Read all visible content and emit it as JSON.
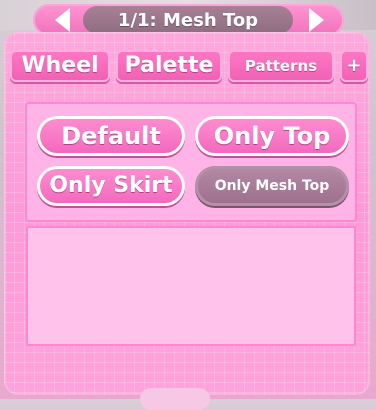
{
  "header": {
    "title": "1/1: Mesh Top",
    "prev_icon": "left-arrow-icon",
    "next_icon": "right-arrow-icon"
  },
  "tabs": [
    {
      "label": "Wheel"
    },
    {
      "label": "Palette"
    },
    {
      "label": "Patterns"
    },
    {
      "label": "+"
    }
  ],
  "presets": [
    {
      "label": "Default",
      "state": "active"
    },
    {
      "label": "Only Top",
      "state": "active"
    },
    {
      "label": "Only Skirt",
      "state": "active"
    },
    {
      "label": "Only Mesh Top",
      "state": "selected"
    }
  ],
  "colors": {
    "accent": "#f070bd",
    "panel": "#ffa8dd",
    "selected_button": "#a57a96"
  }
}
